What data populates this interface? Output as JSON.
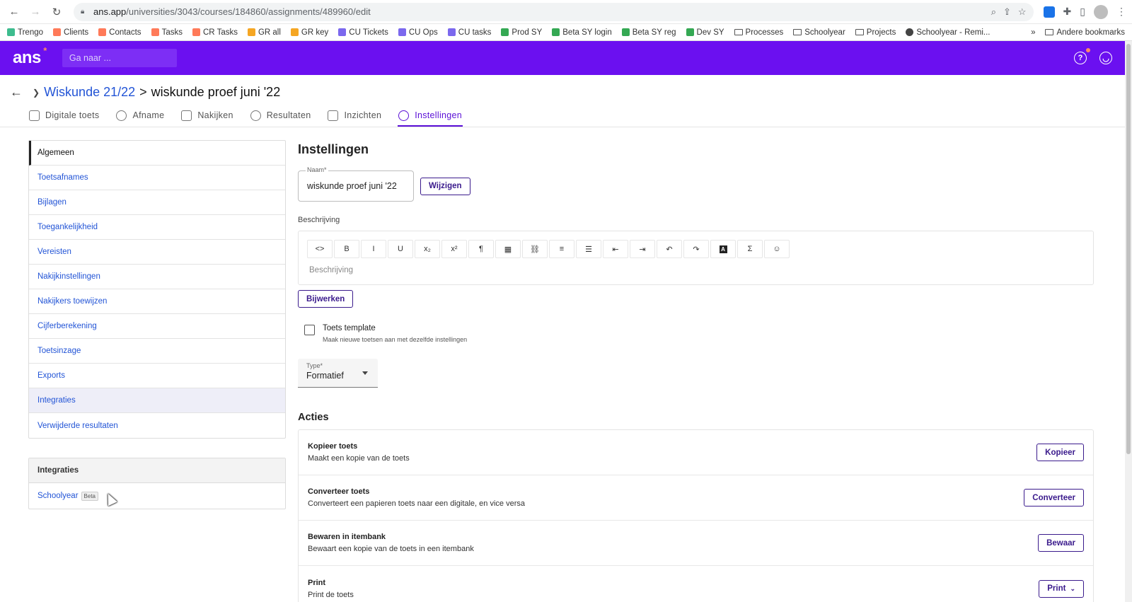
{
  "browser": {
    "url_host": "ans.app",
    "url_path": "/universities/3043/courses/184860/assignments/489960/edit",
    "bookmarks": [
      {
        "label": "Trengo",
        "color": "#3dbc8e"
      },
      {
        "label": "Clients",
        "color": "#ff7a59"
      },
      {
        "label": "Contacts",
        "color": "#ff7a59"
      },
      {
        "label": "Tasks",
        "color": "#ff7a59"
      },
      {
        "label": "CR Tasks",
        "color": "#ff7a59"
      },
      {
        "label": "GR all",
        "color": "#f5a623"
      },
      {
        "label": "GR key",
        "color": "#f5a623"
      },
      {
        "label": "CU Tickets",
        "color": "#7b68ee"
      },
      {
        "label": "CU Ops",
        "color": "#7b68ee"
      },
      {
        "label": "CU tasks",
        "color": "#7b68ee"
      },
      {
        "label": "Prod SY",
        "color": "#34a853"
      },
      {
        "label": "Beta SY login",
        "color": "#34a853"
      },
      {
        "label": "Beta SY reg",
        "color": "#34a853"
      },
      {
        "label": "Dev SY",
        "color": "#34a853"
      }
    ],
    "folders": [
      "Processes",
      "Schoolyear",
      "Projects"
    ],
    "last_bookmark": "Schoolyear - Remi...",
    "more": "»",
    "other_bookmarks": "Andere bookmarks"
  },
  "header": {
    "logo": "ans",
    "logo_star": "*",
    "search_placeholder": "Ga naar ...",
    "accent": "#6b10f0"
  },
  "breadcrumb": {
    "parent": "Wiskunde 21/22",
    "separator": ">",
    "current": "wiskunde proef juni '22"
  },
  "tabs": [
    {
      "label": "Digitale toets",
      "icon": "puzzle-icon"
    },
    {
      "label": "Afname",
      "icon": "play-icon"
    },
    {
      "label": "Nakijken",
      "icon": "comment-icon"
    },
    {
      "label": "Resultaten",
      "icon": "shield-icon"
    },
    {
      "label": "Inzichten",
      "icon": "chart-icon"
    },
    {
      "label": "Instellingen",
      "icon": "gear-icon",
      "active": true
    }
  ],
  "sidebar": {
    "items": [
      "Algemeen",
      "Toetsafnames",
      "Bijlagen",
      "Toegankelijkheid",
      "Vereisten",
      "Nakijkinstellingen",
      "Nakijkers toewijzen",
      "Cijferberekening",
      "Toetsinzage",
      "Exports",
      "Integraties",
      "Verwijderde resultaten"
    ],
    "integrations_heading": "Integraties",
    "integrations_item": "Schoolyear",
    "integrations_badge": "Beta"
  },
  "main": {
    "title": "Instellingen",
    "name_label": "Naam*",
    "name_value": "wiskunde proef juni '22",
    "change_button": "Wijzigen",
    "description_label": "Beschrijving",
    "description_placeholder": "Beschrijving",
    "update_button": "Bijwerken",
    "toolbar": [
      "<>",
      "B",
      "I",
      "U",
      "x₂",
      "x²",
      "¶",
      "▦",
      "⛓",
      "≡",
      "☰",
      "⇤",
      "⇥",
      "↶",
      "↷",
      "A",
      "Σ",
      "☺"
    ],
    "template_title": "Toets template",
    "template_sub": "Maak nieuwe toetsen aan met dezelfde instellingen",
    "type_label": "Type*",
    "type_value": "Formatief",
    "actions_title": "Acties",
    "actions": [
      {
        "title": "Kopieer toets",
        "desc": "Maakt een kopie van de toets",
        "button": "Kopieer"
      },
      {
        "title": "Converteer toets",
        "desc": "Converteert een papieren toets naar een digitale, en vice versa",
        "button": "Converteer"
      },
      {
        "title": "Bewaren in itembank",
        "desc": "Bewaart een kopie van de toets in een itembank",
        "button": "Bewaar"
      },
      {
        "title": "Print",
        "desc": "Print de toets",
        "button": "Print"
      }
    ]
  }
}
